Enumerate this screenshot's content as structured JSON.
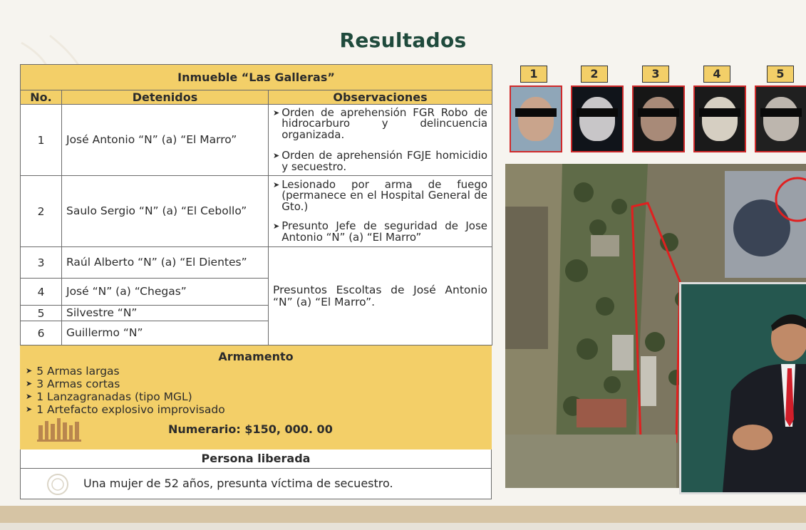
{
  "title": "Resultados",
  "table": {
    "header": "Inmueble  “Las Galleras”",
    "columns": [
      "No.",
      "Detenidos",
      "Observaciones"
    ],
    "rows": [
      {
        "no": "1",
        "detenido": "José Antonio “N” (a) “El Marro”"
      },
      {
        "no": "2",
        "detenido": "Saulo Sergio “N” (a) “El Cebollo”"
      },
      {
        "no": "3",
        "detenido": "Raúl Alberto “N” (a) “El Dientes”"
      },
      {
        "no": "4",
        "detenido": "José “N” (a) “Chegas”"
      },
      {
        "no": "5",
        "detenido": "Silvestre “N”"
      },
      {
        "no": "6",
        "detenido": "Guillermo “N”"
      }
    ],
    "observaciones": {
      "row1": [
        "Orden de aprehensión FGR Robo de hidrocarburo y delincuencia organizada.",
        "Orden de aprehensión FGJE homicidio y secuestro."
      ],
      "row2": [
        "Lesionado por arma de fuego (permanece en el Hospital General de Gto.)",
        "Presunto Jefe de seguridad de Jose Antonio “N” (a) “El Marro”"
      ],
      "rows3to6": "Presuntos Escoltas de José Antonio “N” (a) “El Marro”."
    }
  },
  "armamento": {
    "title": "Armamento",
    "items": [
      "5 Armas largas",
      "3 Armas cortas",
      "1 Lanzagranadas (tipo MGL)",
      "1 Artefacto explosivo improvisado"
    ],
    "numerario": "Numerario:  $150, 000. 00"
  },
  "persona_liberada": {
    "title": "Persona liberada",
    "text": "Una mujer de 52 años, presunta víctima de secuestro."
  },
  "photos": [
    "1",
    "2",
    "3",
    "4",
    "5"
  ],
  "colors": {
    "yellow": "#f3cf68",
    "title_green": "#1f4a3c",
    "photo_border": "#d02a2a",
    "interpreter_bg": "#25574f"
  }
}
